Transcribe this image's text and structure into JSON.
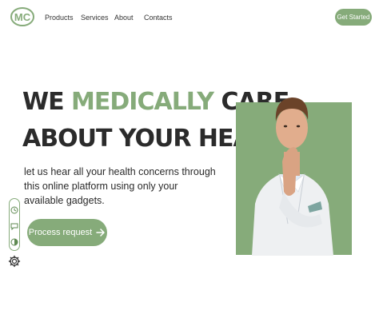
{
  "brand": {
    "logo_text": "MC"
  },
  "nav": {
    "products": "Products",
    "services": "Services",
    "about": "About",
    "contacts": "Contacts",
    "cta": "Get Started"
  },
  "hero": {
    "headline_part1": "WE",
    "headline_accent": "MEDICALLY",
    "headline_part2": "CARE",
    "headline_line2": "ABOUT YOUR HEALTH",
    "subtitle": "let us hear all your health concerns through this online platform using only your available gadgets.",
    "button_label": "Process request"
  },
  "colors": {
    "accent": "#86ab7a",
    "text": "#2b2b2b"
  },
  "icons": [
    "history-icon",
    "chat-icon",
    "theme-toggle-icon",
    "settings-icon",
    "arrow-right-icon"
  ]
}
